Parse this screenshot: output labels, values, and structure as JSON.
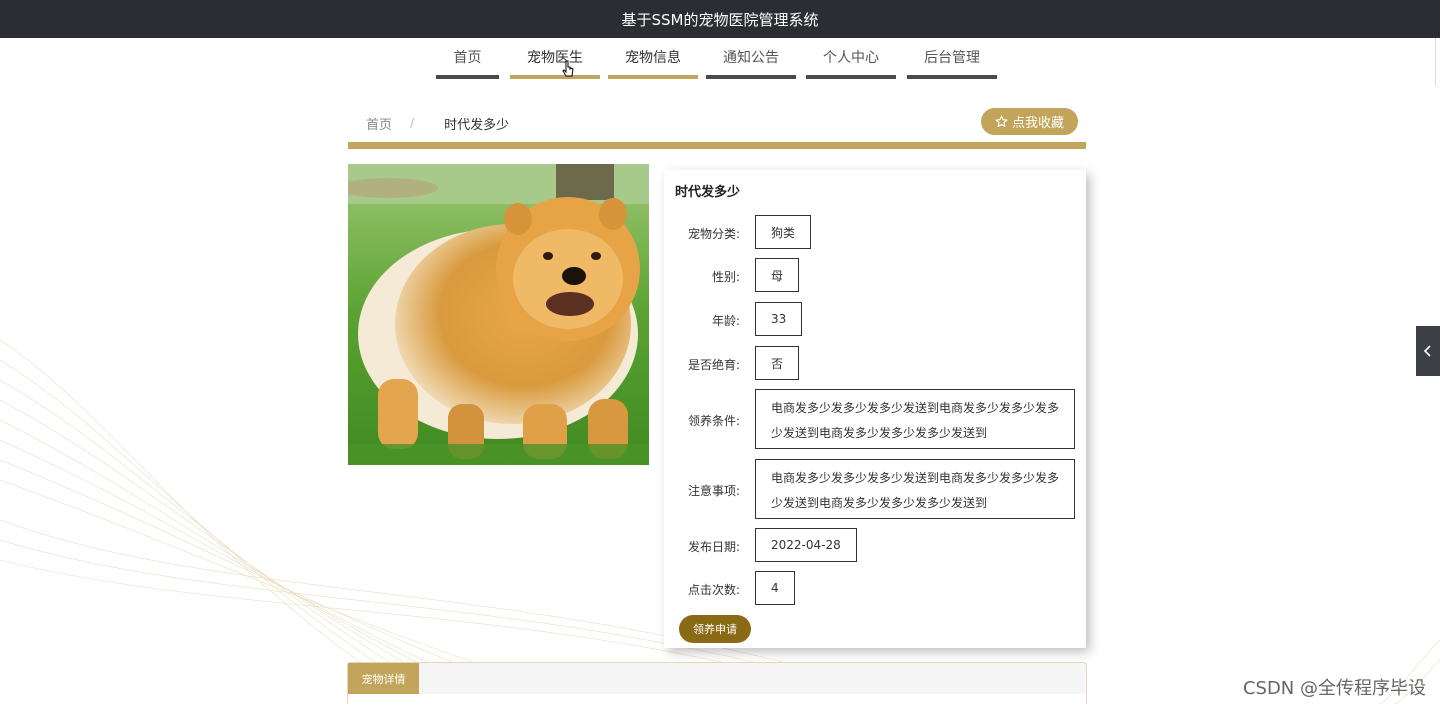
{
  "header": {
    "title": "基于SSM的宠物医院管理系统"
  },
  "nav": {
    "items": [
      {
        "label": "首页"
      },
      {
        "label": "宠物医生"
      },
      {
        "label": "宠物信息"
      },
      {
        "label": "通知公告"
      },
      {
        "label": "个人中心"
      },
      {
        "label": "后台管理"
      }
    ]
  },
  "breadcrumb": {
    "home": "首页",
    "separator": "/",
    "current": "时代发多少"
  },
  "favorite_button": {
    "label": "点我收藏",
    "icon": "star-outline-icon"
  },
  "pet": {
    "title": "时代发多少",
    "fields": [
      {
        "label": "宠物分类:",
        "value": "狗类"
      },
      {
        "label": "性别:",
        "value": "母"
      },
      {
        "label": "年龄:",
        "value": "33"
      },
      {
        "label": "是否绝育:",
        "value": "否"
      },
      {
        "label": "领养条件:",
        "value": "电商发多少发多少发多少发送到电商发多少发多少发多少发送到电商发多少发多少发多少发送到"
      },
      {
        "label": "注意事项:",
        "value": "电商发多少发多少发多少发送到电商发多少发多少发多少发送到电商发多少发多少发多少发送到"
      },
      {
        "label": "发布日期:",
        "value": "2022-04-28"
      },
      {
        "label": "点击次数:",
        "value": "4"
      }
    ]
  },
  "adopt_button": {
    "label": "领养申请"
  },
  "details_tab": {
    "label": "宠物详情"
  },
  "side_toggle": {
    "icon": "chevron-left-icon"
  },
  "watermark": {
    "text": "CSDN @全传程序毕设"
  },
  "colors": {
    "accent": "#c2a45a",
    "header_bg": "#2b2d33",
    "adopt_btn": "#8b6a15",
    "nav_underline": "#4a4a4a"
  }
}
